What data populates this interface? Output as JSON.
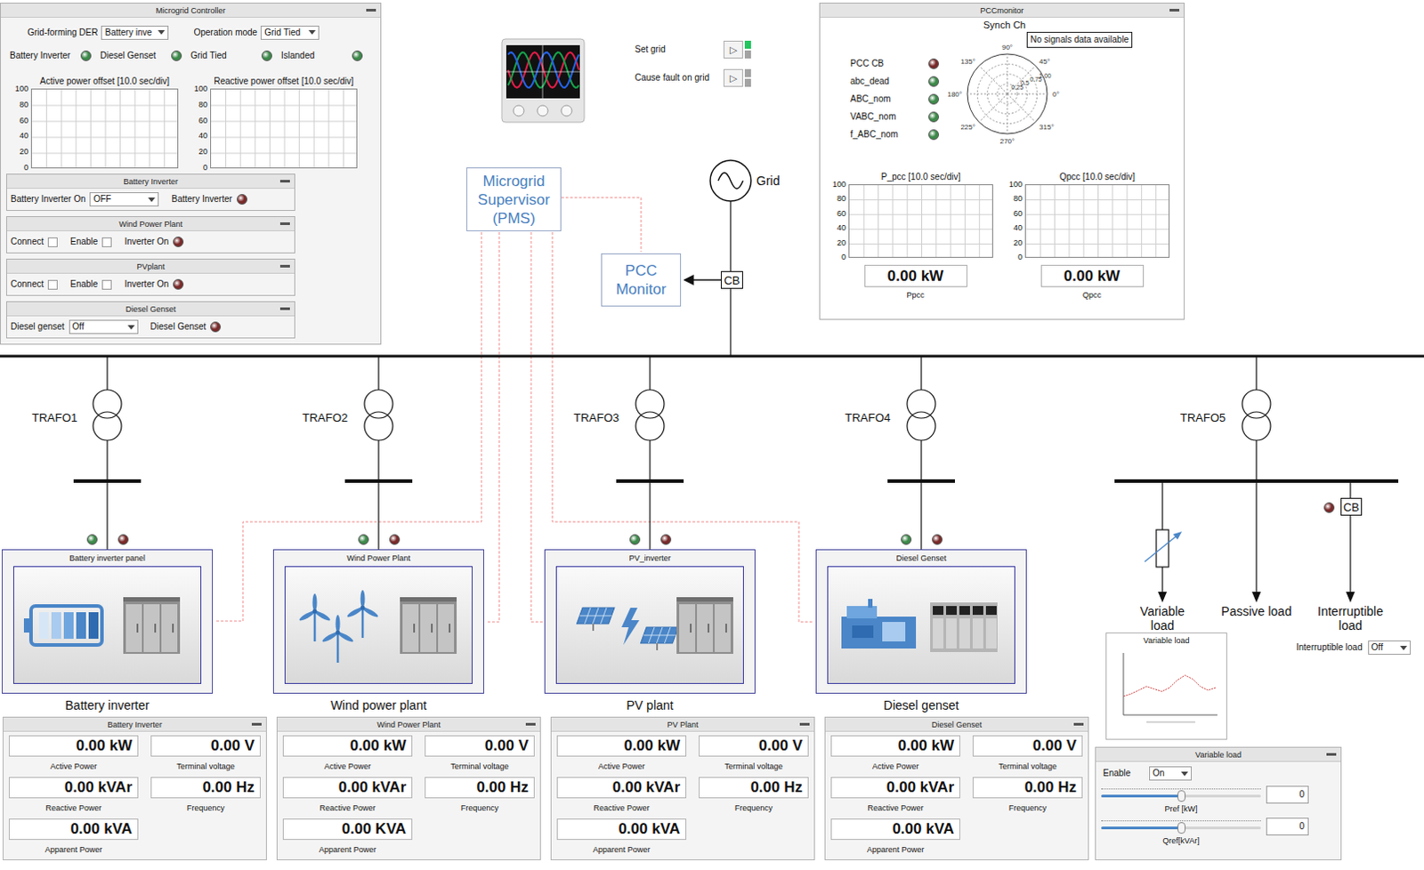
{
  "controller": {
    "title": "Microgrid Controller",
    "selectors": [
      {
        "label": "Grid-forming DER",
        "value": "Battery inve"
      },
      {
        "label": "Operation mode",
        "value": "Grid Tied"
      }
    ],
    "indicators": [
      {
        "label": "Battery Inverter",
        "color": "#3d8a4a"
      },
      {
        "label": "Diesel Genset",
        "color": "#3d8a4a"
      },
      {
        "label": "Grid Tied",
        "color": "#3d8a4a"
      },
      {
        "label": "Islanded",
        "color": "#3d8a4a"
      }
    ],
    "charts": [
      {
        "title": "Active power offset [10.0 sec/div]",
        "ticks": [
          "100",
          "80",
          "60",
          "40",
          "20",
          "0"
        ],
        "values": []
      },
      {
        "title": "Reactive power offset [10.0 sec/div]",
        "ticks": [
          "100",
          "80",
          "60",
          "40",
          "20",
          "0"
        ],
        "values": []
      }
    ],
    "subpanels": [
      {
        "title": "Battery Inverter",
        "rows": [
          {
            "kind": "dropdown",
            "label": "Battery Inverter On",
            "value": "OFF"
          },
          {
            "kind": "led",
            "label": "Battery Inverter",
            "color": "#7a2a2a"
          }
        ]
      },
      {
        "title": "Wind Power Plant",
        "rows": [
          {
            "kind": "checkbox",
            "label": "Connect",
            "checked": false
          },
          {
            "kind": "checkbox",
            "label": "Enable",
            "checked": false
          },
          {
            "kind": "led",
            "label": "Inverter On",
            "color": "#7a2a2a"
          }
        ]
      },
      {
        "title": "PVplant",
        "rows": [
          {
            "kind": "checkbox",
            "label": "Connect",
            "checked": false
          },
          {
            "kind": "checkbox",
            "label": "Enable",
            "checked": false
          },
          {
            "kind": "led",
            "label": "Inverter On",
            "color": "#7a2a2a"
          }
        ]
      },
      {
        "title": "Diesel Genset",
        "rows": [
          {
            "kind": "dropdown",
            "label": "Diesel genset",
            "value": "Off"
          },
          {
            "kind": "led",
            "label": "Diesel Genset",
            "color": "#7a2a2a"
          }
        ]
      }
    ]
  },
  "grid_actions": [
    {
      "label": "Set grid",
      "icon": "▷",
      "indicators": [
        "#22c55e",
        "#a3a3a3"
      ]
    },
    {
      "label": "Cause fault on grid",
      "icon": "▷",
      "indicators": [
        "#a3a3a3",
        "#a3a3a3"
      ]
    }
  ],
  "pcc": {
    "title": "PCCmonitor",
    "leds": [
      {
        "label": "PCC CB",
        "color": "#7a2a2a"
      },
      {
        "label": "abc_dead",
        "color": "#3d8a4a"
      },
      {
        "label": "ABC_nom",
        "color": "#3d8a4a"
      },
      {
        "label": "VABC_nom",
        "color": "#3d8a4a"
      },
      {
        "label": "f_ABC_nom",
        "color": "#3d8a4a"
      }
    ],
    "polar": {
      "title": "Synch Ch",
      "tooltip": "No signals data available",
      "angles": [
        "0°",
        "45°",
        "90°",
        "135°",
        "180°",
        "225°",
        "270°",
        "315°"
      ],
      "rings": [
        "0.25",
        "0.5",
        "0.75",
        "1.00"
      ]
    },
    "charts": [
      {
        "title": "P_pcc [10.0 sec/div]",
        "ticks": [
          "100",
          "80",
          "60",
          "40",
          "20",
          "0"
        ],
        "values": [],
        "reading": "0.00 kW",
        "caption": "Ppcc"
      },
      {
        "title": "Qpcc [10.0 sec/div]",
        "ticks": [
          "100",
          "80",
          "60",
          "40",
          "20",
          "0"
        ],
        "values": [],
        "reading": "0.00 kW",
        "caption": "Qpcc"
      }
    ]
  },
  "diagram": {
    "grid": "Grid",
    "pcc_cb": "CB",
    "pms": [
      "Microgrid",
      "Supervisor",
      "(PMS)"
    ],
    "pcc_box": [
      "PCC",
      "Monitor"
    ],
    "transformers": [
      "TRAFO1",
      "TRAFO2",
      "TRAFO3",
      "TRAFO4",
      "TRAFO5"
    ]
  },
  "ders": [
    {
      "kind": "battery",
      "panel_title": "Battery inverter panel",
      "label": "Battery inverter",
      "leds": [
        "#3d8a4a",
        "#7a2a2a"
      ],
      "readout": {
        "title": "Battery Inverter",
        "left": [
          {
            "value": "0.00 kW",
            "caption": "Active Power"
          },
          {
            "value": "0.00 kVAr",
            "caption": "Reactive Power"
          },
          {
            "value": "0.00 kVA",
            "caption": "Apparent Power"
          }
        ],
        "right": [
          {
            "value": "0.00 V",
            "caption": "Terminal voltage"
          },
          {
            "value": "0.00 Hz",
            "caption": "Frequency"
          }
        ]
      }
    },
    {
      "kind": "wind",
      "panel_title": "Wind Power Plant",
      "label": "Wind power plant",
      "leds": [
        "#3d8a4a",
        "#7a2a2a"
      ],
      "readout": {
        "title": "Wind Power Plant",
        "left": [
          {
            "value": "0.00 kW",
            "caption": "Active Power"
          },
          {
            "value": "0.00 kVAr",
            "caption": "Reactive Power"
          },
          {
            "value": "0.00 KVA",
            "caption": "Apparent Power"
          }
        ],
        "right": [
          {
            "value": "0.00 V",
            "caption": "Terminal voltage"
          },
          {
            "value": "0.00 Hz",
            "caption": "Frequency"
          }
        ]
      }
    },
    {
      "kind": "pv",
      "panel_title": "PV_inverter",
      "label": "PV plant",
      "leds": [
        "#3d8a4a",
        "#7a2a2a"
      ],
      "readout": {
        "title": "PV Plant",
        "left": [
          {
            "value": "0.00 kW",
            "caption": "Active Power"
          },
          {
            "value": "0.00 kVAr",
            "caption": "Reactive Power"
          },
          {
            "value": "0.00 kVA",
            "caption": "Apparent Power"
          }
        ],
        "right": [
          {
            "value": "0.00 V",
            "caption": "Terminal voltage"
          },
          {
            "value": "0.00 Hz",
            "caption": "Frequency"
          }
        ]
      }
    },
    {
      "kind": "diesel",
      "panel_title": "Diesel Genset",
      "label": "Diesel genset",
      "leds": [
        "#3d8a4a",
        "#7a2a2a"
      ],
      "readout": {
        "title": "Diesel Genset",
        "left": [
          {
            "value": "0.00 kW",
            "caption": "Active Power"
          },
          {
            "value": "0.00 kVAr",
            "caption": "Reactive Power"
          },
          {
            "value": "0.00 kVA",
            "caption": "Apparent Power"
          }
        ],
        "right": [
          {
            "value": "0.00 V",
            "caption": "Terminal voltage"
          },
          {
            "value": "0.00 Hz",
            "caption": "Frequency"
          }
        ]
      }
    }
  ],
  "loads": {
    "items": [
      {
        "kind": "variable",
        "label": "Variable load"
      },
      {
        "kind": "passive",
        "label": "Passive load"
      },
      {
        "kind": "interruptible",
        "label": "Interruptible load",
        "cb": "CB",
        "led": "#7a2a2a"
      }
    ],
    "interruptible_select": {
      "label": "Interruptible load",
      "value": "Off"
    },
    "preview": {
      "title": "Variable load",
      "values": [
        30,
        34,
        40,
        46,
        42,
        38,
        44,
        56,
        64,
        58,
        46,
        40,
        44
      ]
    },
    "panel": {
      "title": "Variable load",
      "enable": {
        "label": "Enable",
        "value": "On"
      },
      "sliders": [
        {
          "label": "Pref [kW]",
          "level": 0.5,
          "value": "0"
        },
        {
          "label": "Qref[kVAr]",
          "level": 0.5,
          "value": "0"
        }
      ]
    }
  }
}
